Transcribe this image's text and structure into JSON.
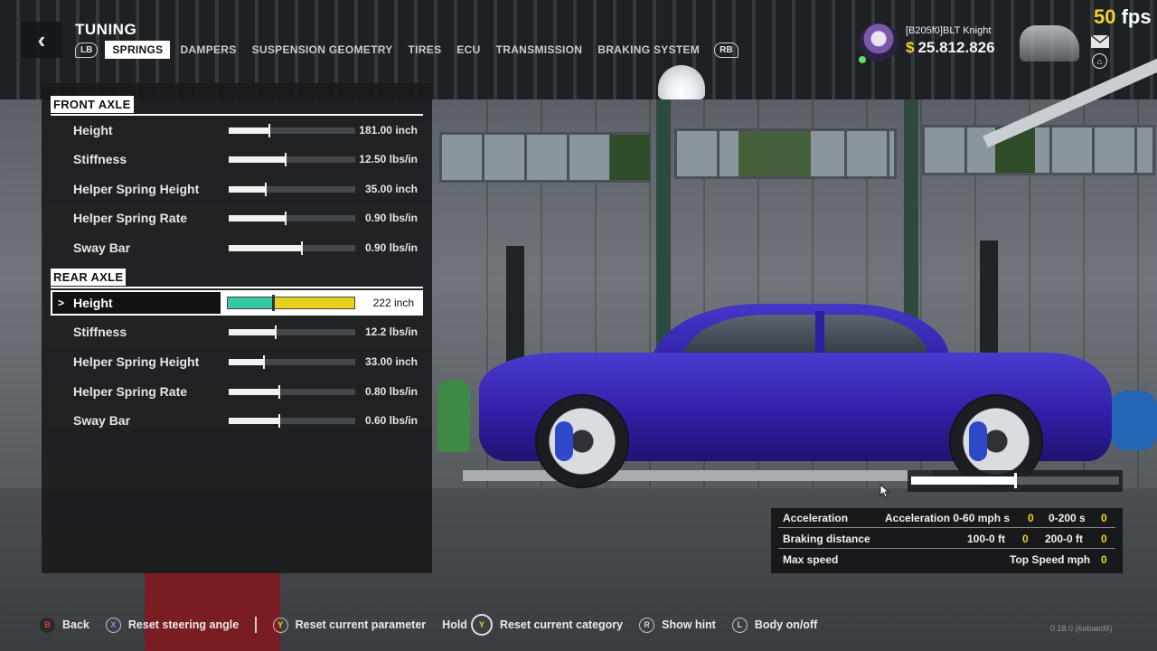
{
  "header": {
    "back_icon": "chevron-left-icon",
    "title": "TUNING",
    "lb": "LB",
    "rb": "RB",
    "tabs": [
      {
        "label": "SPRINGS",
        "active": true
      },
      {
        "label": "DAMPERS",
        "active": false
      },
      {
        "label": "SUSPENSION GEOMETRY",
        "active": false
      },
      {
        "label": "TIRES",
        "active": false
      },
      {
        "label": "ECU",
        "active": false
      },
      {
        "label": "TRANSMISSION",
        "active": false
      },
      {
        "label": "BRAKING SYSTEM",
        "active": false
      }
    ]
  },
  "fps": {
    "value": "50",
    "unit": "fps"
  },
  "profile": {
    "name": "[B205f0]BLT Knight",
    "currency_symbol": "$",
    "money": "25.812.826",
    "mail_icon": "mail-icon",
    "garage_icon": "garage-icon"
  },
  "front_axle": {
    "title": "FRONT AXLE",
    "params": [
      {
        "name": "Height",
        "value": "181.00 inch",
        "level": 0.32
      },
      {
        "name": "Stiffness",
        "value": "12.50 lbs/in",
        "level": 0.45
      },
      {
        "name": "Helper Spring Height",
        "value": "35.00 inch",
        "level": 0.29
      },
      {
        "name": "Helper Spring Rate",
        "value": "0.90 lbs/in",
        "level": 0.45
      },
      {
        "name": "Sway Bar",
        "value": "0.90 lbs/in",
        "level": 0.58
      }
    ]
  },
  "rear_axle": {
    "title": "REAR AXLE",
    "selected": {
      "marker": ">",
      "name": "Height",
      "value": "222 inch",
      "level": 0.36
    },
    "params": [
      {
        "name": "Stiffness",
        "value": "12.2 lbs/in",
        "level": 0.37
      },
      {
        "name": "Helper Spring Height",
        "value": "33.00 inch",
        "level": 0.28
      },
      {
        "name": "Helper Spring Rate",
        "value": "0.80 lbs/in",
        "level": 0.4
      },
      {
        "name": "Sway Bar",
        "value": "0.60 lbs/in",
        "level": 0.4
      }
    ]
  },
  "stats": {
    "slider_level": 0.5,
    "rows": [
      {
        "name": "Acceleration",
        "cells": [
          {
            "label": "Acceleration 0-60 mph s",
            "value": "0"
          },
          {
            "label": "0-200 s",
            "value": "0"
          }
        ]
      },
      {
        "name": "Braking distance",
        "cells": [
          {
            "label": "100-0 ft",
            "value": "0"
          },
          {
            "label": "200-0 ft",
            "value": "0"
          }
        ]
      },
      {
        "name": "Max speed",
        "cells": [
          {
            "label": "Top Speed mph",
            "value": "0"
          }
        ]
      }
    ]
  },
  "hints": {
    "back": {
      "button": "B",
      "label": "Back"
    },
    "reset_steering": {
      "button": "X",
      "label": "Reset steering angle"
    },
    "reset_param": {
      "button": "Y",
      "label": "Reset current parameter"
    },
    "reset_category": {
      "prefix": "Hold",
      "button": "Y",
      "label": "Reset current category"
    },
    "show_hint": {
      "button": "R",
      "label": "Show hint"
    },
    "body_toggle": {
      "button": "L",
      "label": "Body on/off"
    }
  },
  "version": "0.18.0 (6ebaed8)",
  "colors": {
    "accent_yellow": "#f1d42a",
    "slider_teal": "#34c9a6",
    "slider_yellow": "#e6d21c",
    "car_purple": "#3020a8"
  }
}
